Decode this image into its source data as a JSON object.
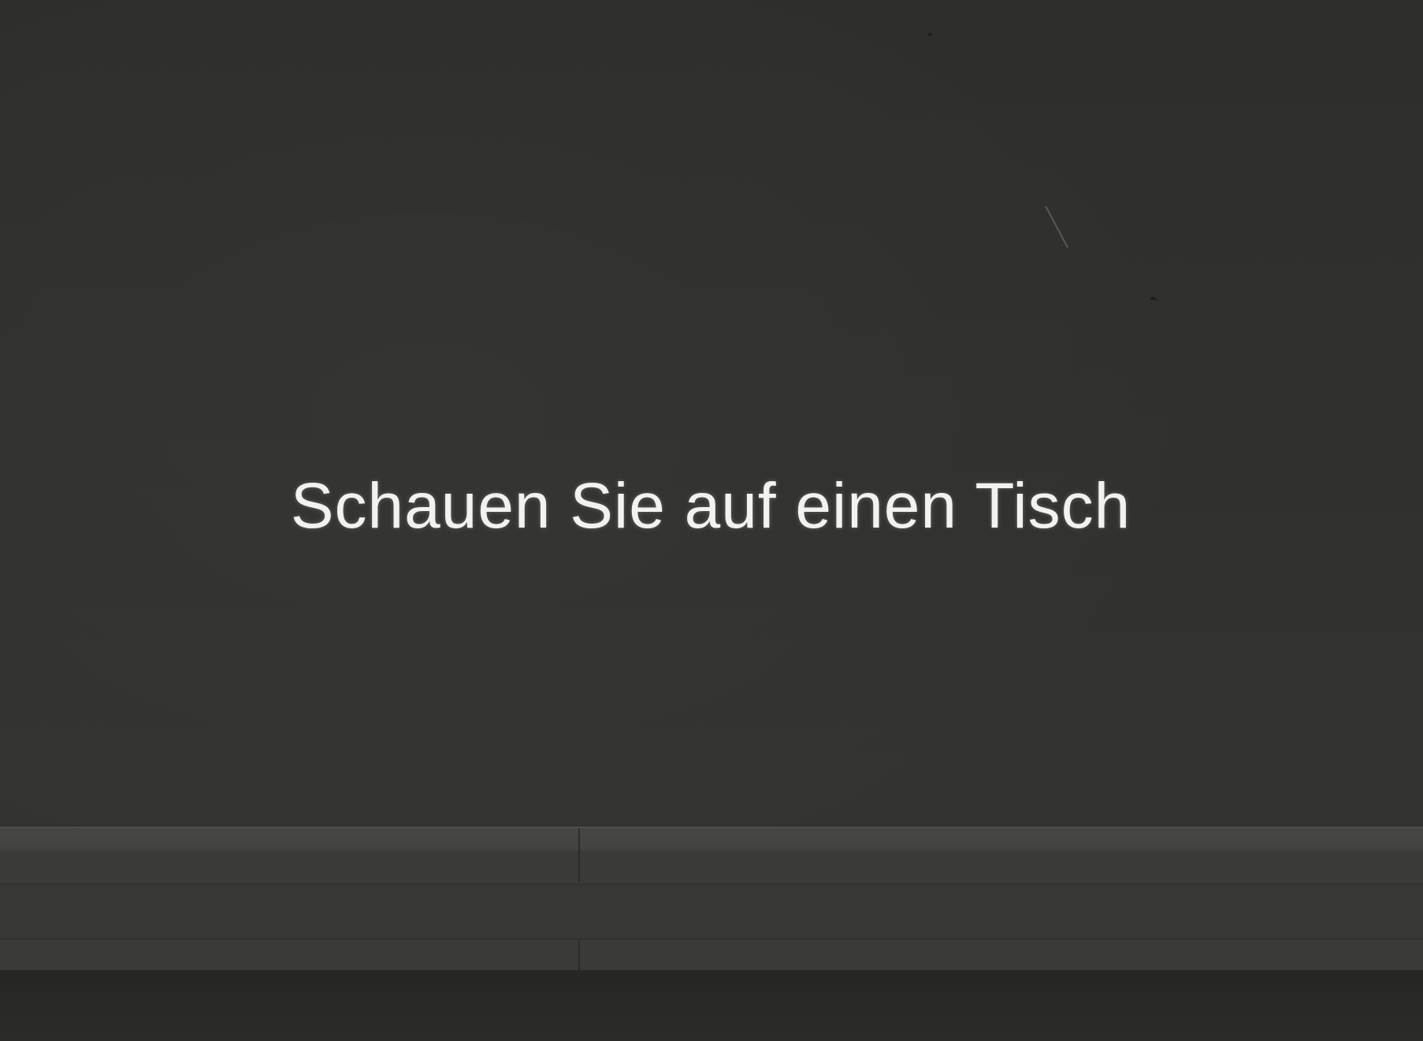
{
  "scene": {
    "instruction_text": "Schauen Sie auf einen Tisch",
    "colors": {
      "wall": "#2f2f2c",
      "text": "#f2f2f0",
      "shelf": "#42423f",
      "floor": "#262624"
    }
  }
}
